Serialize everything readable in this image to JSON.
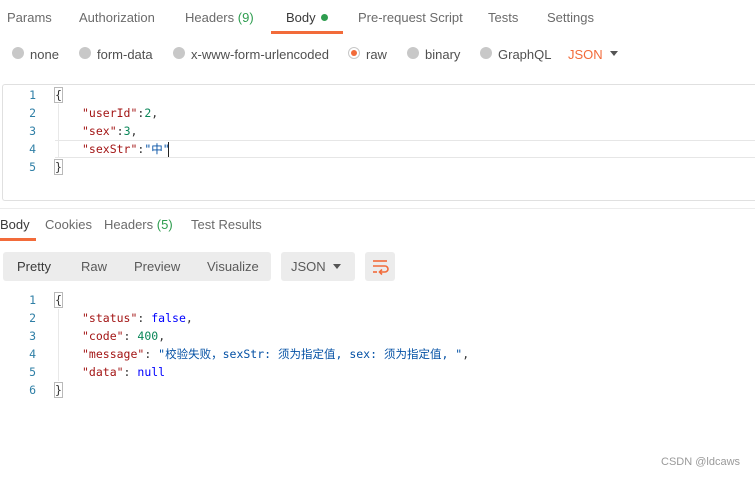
{
  "request_tabs": {
    "params": "Params",
    "authorization": "Authorization",
    "headers": "Headers",
    "headers_count": "(9)",
    "body": "Body",
    "pre_request": "Pre-request Script",
    "tests": "Tests",
    "settings": "Settings"
  },
  "body_options": {
    "none": "none",
    "form_data": "form-data",
    "urlencoded": "x-www-form-urlencoded",
    "raw": "raw",
    "binary": "binary",
    "graphql": "GraphQL",
    "selected": "raw",
    "format": "JSON"
  },
  "request_code": {
    "line_numbers": [
      "1",
      "2",
      "3",
      "4",
      "5"
    ],
    "open": "{",
    "key_userId": "\"userId\"",
    "val_userId": "2",
    "key_sex": "\"sex\"",
    "val_sex": "3",
    "key_sexStr": "\"sexStr\"",
    "val_sexStr": "\"中\"",
    "close": "}"
  },
  "response_tabs": {
    "body": "Body",
    "cookies": "Cookies",
    "headers": "Headers",
    "headers_count": "(5)",
    "test_results": "Test Results"
  },
  "response_view": {
    "pretty": "Pretty",
    "raw": "Raw",
    "preview": "Preview",
    "visualize": "Visualize",
    "format": "JSON"
  },
  "response_code": {
    "line_numbers": [
      "1",
      "2",
      "3",
      "4",
      "5",
      "6"
    ],
    "open": "{",
    "key_status": "\"status\"",
    "val_status": "false",
    "key_code": "\"code\"",
    "val_code": "400",
    "key_message": "\"message\"",
    "val_message": "\"校验失败，sexStr: 须为指定值, sex: 须为指定值, \"",
    "key_data": "\"data\"",
    "val_data": "null",
    "close": "}"
  },
  "watermark": "CSDN @ldcaws",
  "colors": {
    "accent": "#f26b3a",
    "count_green": "#2e9d4f",
    "json_key": "#a31515",
    "json_string": "#0451a5",
    "json_number": "#098658",
    "json_keyword": "#0000ff",
    "line_number": "#2f7fa6"
  },
  "icons": {
    "format_caret": "chevron-down-icon",
    "wrap": "wrap-lines-icon"
  }
}
